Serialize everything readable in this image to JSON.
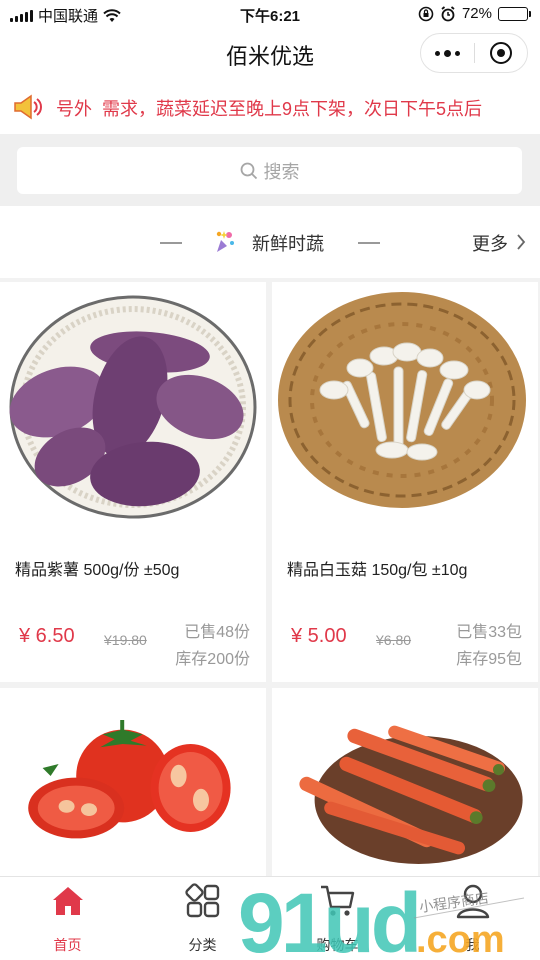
{
  "status_bar": {
    "carrier": "中国联通",
    "time": "下午6:21",
    "battery": "72%",
    "battery_level": 0.72,
    "icons": [
      "signal-icon",
      "wifi-icon",
      "rotation-lock-icon",
      "alarm-icon",
      "battery-icon"
    ]
  },
  "nav": {
    "title": "佰米优选",
    "icons": [
      "more-icon",
      "close-icon"
    ]
  },
  "notice": {
    "text": "号外  需求，蔬菜延迟至晚上9点下架，次日下午5点后",
    "icon": "speaker-icon"
  },
  "search": {
    "placeholder": "搜索",
    "icon": "search-icon"
  },
  "section": {
    "title": "新鲜时蔬",
    "more": "更多",
    "icon": "sparkle-icon"
  },
  "products": [
    {
      "name": "精品紫薯 500g/份 ±50g",
      "price": "¥ 6.50",
      "original_price": "¥19.80",
      "sold": "已售48份",
      "stock": "库存200份",
      "image": "purple-sweet-potato-image"
    },
    {
      "name": "精品白玉菇 150g/包 ±10g",
      "price": "¥ 5.00",
      "original_price": "¥6.80",
      "sold": "已售33包",
      "stock": "库存95包",
      "image": "white-mushroom-image"
    },
    {
      "image": "tomato-image"
    },
    {
      "image": "carrot-image"
    }
  ],
  "tabs": [
    {
      "label": "首页",
      "icon": "home-icon",
      "active": true
    },
    {
      "label": "分类",
      "icon": "category-icon",
      "active": false
    },
    {
      "label": "购物车",
      "icon": "cart-icon",
      "active": false
    },
    {
      "label": "我",
      "icon": "profile-icon",
      "active": false
    }
  ],
  "watermark": {
    "text": "91ud.com",
    "small_text": "小程序商店"
  },
  "colors": {
    "accent": "#e0394a",
    "muted": "#999999",
    "watermark_teal": "#3fc5b5",
    "watermark_orange": "#f5a623"
  }
}
